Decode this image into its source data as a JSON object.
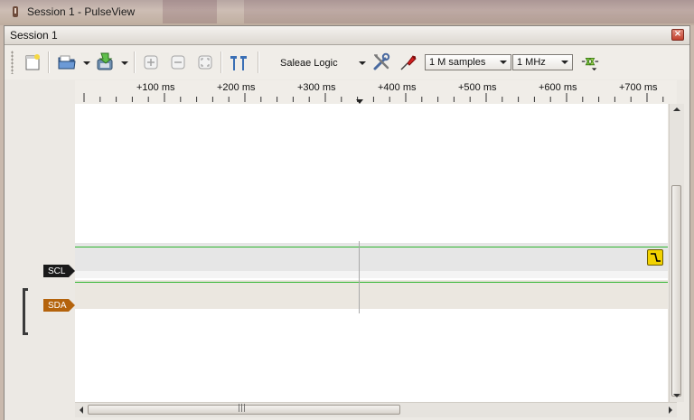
{
  "window": {
    "title": "Session 1 - PulseView"
  },
  "session": {
    "title": "Session 1",
    "close_glyph": "×"
  },
  "toolbar": {
    "device": "Saleae Logic",
    "samples": "1 M samples",
    "samplerate": "1 MHz",
    "icons": [
      "new-session-icon",
      "open-icon",
      "save-icon",
      "zoom-in-icon",
      "zoom-out-icon",
      "zoom-fit-icon",
      "cursors-icon",
      "device-config-icon",
      "probes-icon",
      "run-icon"
    ]
  },
  "ruler": {
    "labels": [
      "+100 ms",
      "+200 ms",
      "+300 ms",
      "+400 ms",
      "+500 ms",
      "+600 ms",
      "+700 ms"
    ]
  },
  "signals": [
    {
      "name": "SCL",
      "color": "#1a1a1a",
      "text_color": "#ffffff"
    },
    {
      "name": "SDA",
      "color": "#b4630c",
      "text_color": "#ffffff"
    }
  ],
  "colors": {
    "trace": "#2fb52f",
    "trigger": "#f2d200"
  },
  "hscroll": {
    "grip_glyph": "|||"
  }
}
